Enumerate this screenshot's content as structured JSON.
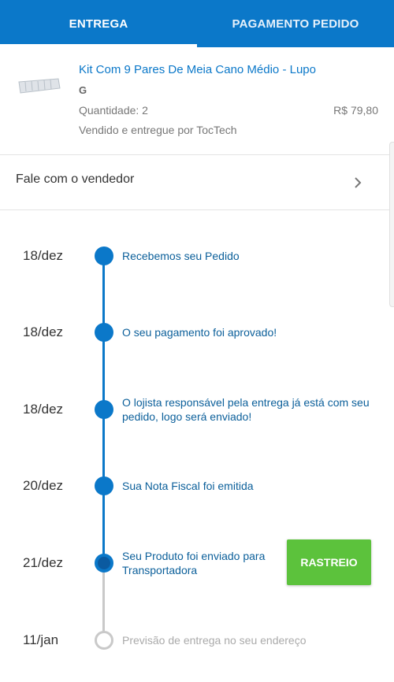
{
  "tabs": [
    {
      "label": "ENTREGA",
      "active": true
    },
    {
      "label": "PAGAMENTO PEDIDO",
      "active": false
    }
  ],
  "product": {
    "title": "Kit Com 9 Pares De Meia Cano Médio - Lupo",
    "size": "G",
    "quantity": "Quantidade: 2",
    "price": "R$ 79,80",
    "seller": "Vendido e entregue por TocTech",
    "thumbnail_icon": "socks-kit-thumbnail"
  },
  "contact": {
    "label": "Fale com o vendedor",
    "icon": "chevron-right-icon"
  },
  "timeline": {
    "steps": [
      {
        "date": "18/dez",
        "text": "Recebemos seu Pedido",
        "status": "done"
      },
      {
        "date": "18/dez",
        "text": "O seu pagamento foi aprovado!",
        "status": "done"
      },
      {
        "date": "18/dez",
        "text": "O lojista responsável pela entrega já está com seu pedido, logo será enviado!",
        "status": "done"
      },
      {
        "date": "20/dez",
        "text": "Sua Nota Fiscal foi emitida",
        "status": "done"
      },
      {
        "date": "21/dez",
        "text": "Seu Produto foi enviado para Transportadora",
        "status": "current"
      },
      {
        "date": "11/jan",
        "text": "Previsão de entrega no seu endereço",
        "status": "pending"
      }
    ],
    "track_button": "RASTREIO"
  },
  "colors": {
    "primary": "#0b78c9",
    "success": "#5cc23c",
    "pending": "#c9c9c9"
  }
}
